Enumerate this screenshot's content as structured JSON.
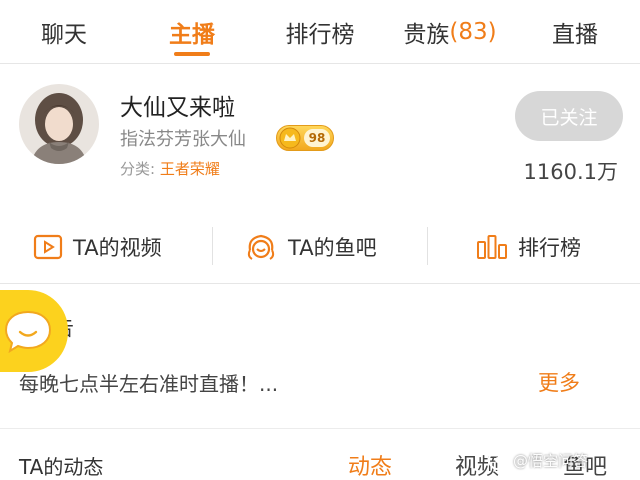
{
  "tabs": [
    {
      "label": "聊天"
    },
    {
      "label": "主播"
    },
    {
      "label": "排行榜"
    },
    {
      "label": "贵族",
      "count": "(83)"
    },
    {
      "label": "直播"
    }
  ],
  "accent_color": "#f07d19",
  "anchor": {
    "name": "大仙又来啦",
    "room_title": "指法芬芳张大仙",
    "level": "98",
    "category_label": "分类:",
    "category": "王者荣耀",
    "follow_label": "已关注",
    "fans": "1160.1万"
  },
  "actions": [
    {
      "label": "TA的视频",
      "icon": "video-play-icon"
    },
    {
      "label": "TA的鱼吧",
      "icon": "fish-bar-icon"
    },
    {
      "label": "排行榜",
      "icon": "ranking-bars-icon"
    }
  ],
  "notice": {
    "title": "公告",
    "text": "每晚七点半左右准时直播！...",
    "more": "更多"
  },
  "dynamics": {
    "title": "TA的动态",
    "tabs": [
      "动态",
      "视频",
      "鱼吧"
    ]
  },
  "watermark": "@悟空问答"
}
